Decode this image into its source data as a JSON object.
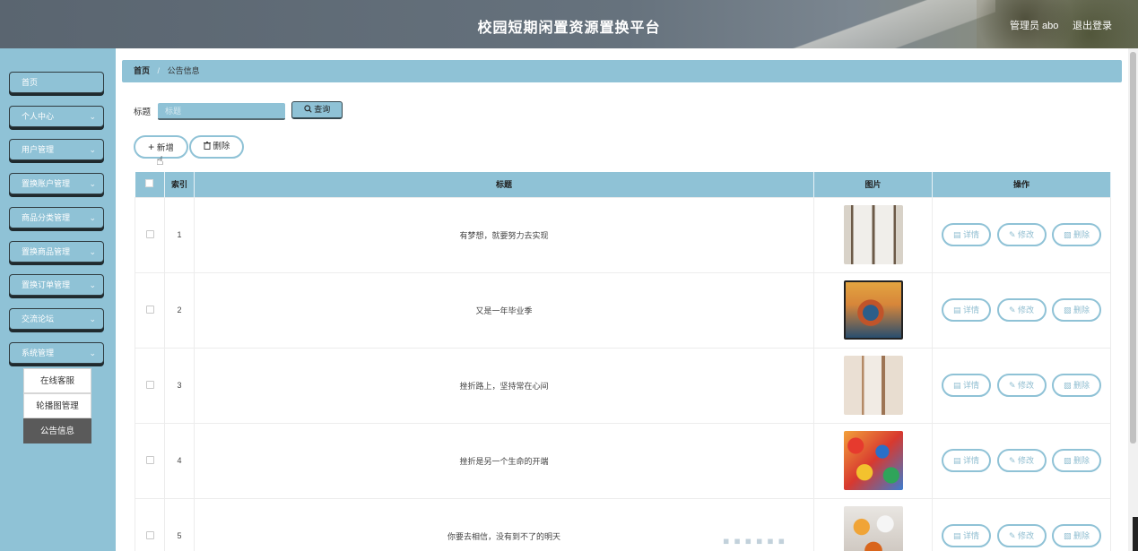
{
  "header": {
    "title": "校园短期闲置资源置换平台",
    "user": "管理员 abo",
    "logout": "退出登录"
  },
  "sidebar": {
    "items": [
      {
        "label": "首页",
        "chevron": false
      },
      {
        "label": "个人中心",
        "chevron": true
      },
      {
        "label": "用户管理",
        "chevron": true
      },
      {
        "label": "置换账户管理",
        "chevron": true
      },
      {
        "label": "商品分类管理",
        "chevron": true
      },
      {
        "label": "置换商品管理",
        "chevron": true
      },
      {
        "label": "置换订单管理",
        "chevron": true
      },
      {
        "label": "交流论坛",
        "chevron": true
      },
      {
        "label": "系统管理",
        "chevron": true
      }
    ],
    "submenu": [
      {
        "label": "在线客服",
        "active": false
      },
      {
        "label": "轮播图管理",
        "active": false
      },
      {
        "label": "公告信息",
        "active": true
      }
    ]
  },
  "breadcrumb": {
    "home": "首页",
    "sep": "/",
    "current": "公告信息"
  },
  "search": {
    "label": "标题",
    "placeholder": "标题",
    "button": "查询",
    "button_icon": "search-icon"
  },
  "actions": {
    "add": "新增",
    "add_icon": "plus-icon",
    "delete": "删除",
    "delete_icon": "trash-icon"
  },
  "table": {
    "headers": [
      "索引",
      "标题",
      "图片",
      "操作"
    ],
    "rows": [
      {
        "index": "1",
        "title": "有梦想，就要努力去实现",
        "image": "fridge-image"
      },
      {
        "index": "2",
        "title": "又是一年毕业季",
        "image": "boat-painting-image"
      },
      {
        "index": "3",
        "title": "挫折路上，坚持常在心间",
        "image": "cabinet-image"
      },
      {
        "index": "4",
        "title": "挫折是另一个生命的开端",
        "image": "toys-image"
      },
      {
        "index": "5",
        "title": "你要去相信，没有到不了的明天",
        "image": "food-image"
      }
    ],
    "row_buttons": {
      "detail": "详情",
      "edit": "修改",
      "delete": "删除"
    }
  },
  "colors": {
    "accent": "#8fc2d6",
    "header": "#5f6b76",
    "active_sub": "#5a5a5a"
  }
}
